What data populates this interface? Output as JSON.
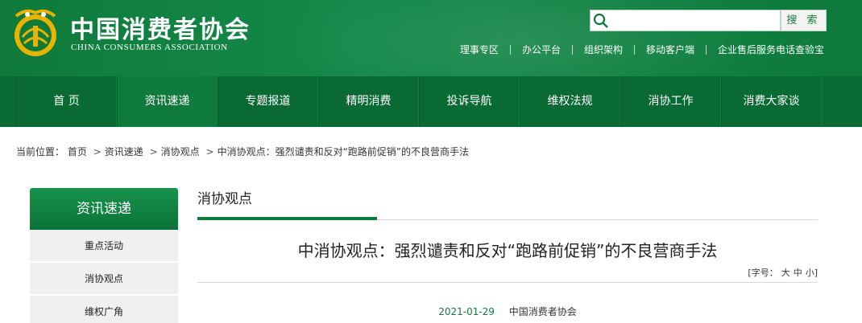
{
  "header": {
    "site_name": "中国消费者协会",
    "site_name_en": "CHINA CONSUMERS ASSOCIATION",
    "logo_icon": "cca-emblem-icon",
    "search": {
      "placeholder": "",
      "button_label": "搜 索",
      "icon": "search-icon"
    },
    "top_links": [
      "理事专区",
      "办公平台",
      "组织架构",
      "移动客户端",
      "企业售后服务电话查验宝"
    ]
  },
  "nav": {
    "items": [
      "首 页",
      "资讯速递",
      "专题报道",
      "精明消费",
      "投诉导航",
      "维权法规",
      "消协工作",
      "消费大家谈"
    ],
    "active_index": 1
  },
  "breadcrumb": {
    "prefix": "当前位置：",
    "items": [
      "首页",
      "资讯速递",
      "消协观点",
      "中消协观点：强烈谴责和反对“跑路前促销”的不良营商手法"
    ],
    "separator": ">"
  },
  "sidebar": {
    "title": "资讯速递",
    "items": [
      "重点活动",
      "消协观点",
      "维权广角"
    ]
  },
  "main": {
    "section_title": "消协观点",
    "article_title": "中消协观点：强烈谴责和反对“跑路前促销”的不良营商手法",
    "font_size": {
      "open": "[",
      "label": "字号：",
      "large": "大",
      "medium": "中",
      "small": "小",
      "close": "]"
    },
    "date": "2021-01-29",
    "source": "中国消费者协会"
  },
  "colors": {
    "brand_green": "#0e7a3c",
    "nav_green": "#0b6b35"
  }
}
